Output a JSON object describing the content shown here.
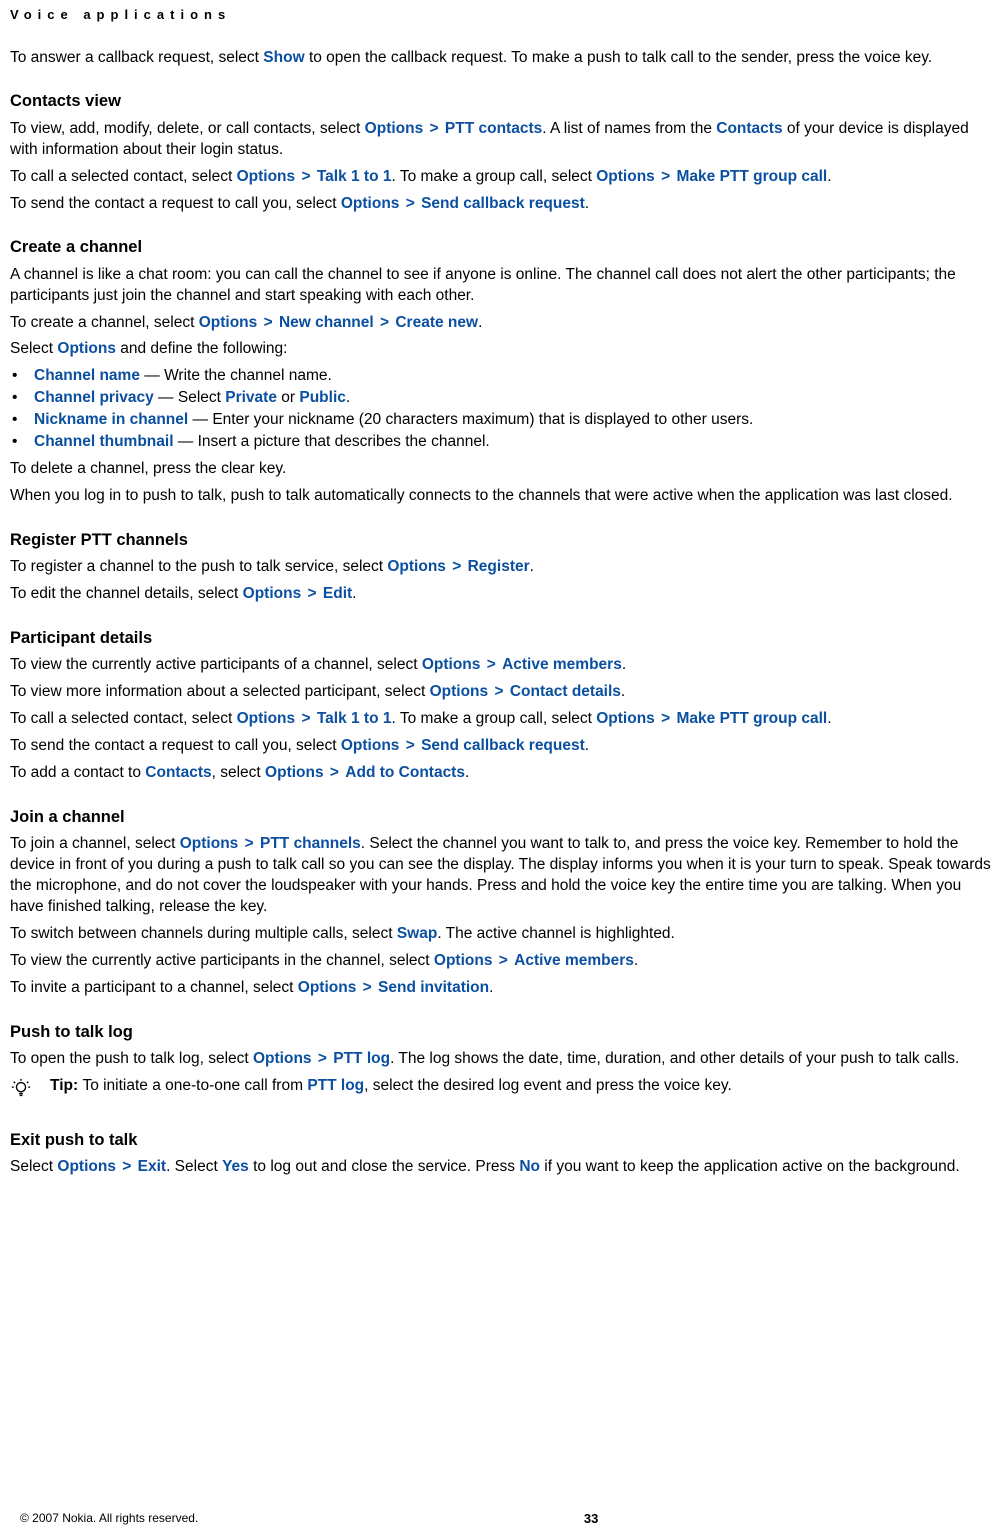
{
  "header": "Voice applications",
  "intro_p1_a": "To answer a callback request, select ",
  "intro_p1_show": "Show",
  "intro_p1_b": " to open the callback request. To make a push to talk call to the sender, press the voice key.",
  "contacts": {
    "h": "Contacts view",
    "p1a": "To view, add, modify, delete, or call contacts, select ",
    "opt": "Options",
    "ptt_contacts": "PTT contacts",
    "p1b": ". A list of names from the ",
    "contacts": "Contacts",
    "p1c": " of your device is displayed with information about their login status.",
    "p2a": "To call a selected contact, select ",
    "talk11": "Talk 1 to 1",
    "p2b": ". To make a group call, select ",
    "makeptt": "Make PTT group call",
    "p2c": ".",
    "p3a": "To send the contact a request to call you, select ",
    "sendcb": "Send callback request",
    "p3b": "."
  },
  "createch": {
    "h": "Create a channel",
    "p1": "A channel is like a chat room: you can call the channel to see if anyone is online. The channel call does not alert the other participants; the participants just join the channel and start speaking with each other.",
    "p2a": "To create a channel, select ",
    "opt": "Options",
    "newch": "New channel",
    "createnew": "Create new",
    "p2b": ".",
    "p3a": "Select ",
    "p3b": " and define the following:",
    "b1_l": "Channel name",
    "b1_r": "  — Write the channel name.",
    "b2_l": "Channel privacy",
    "b2_r_a": "  — Select ",
    "b2_private": "Private",
    "b2_or": " or ",
    "b2_public": "Public",
    "b2_dot": ".",
    "b3_l": "Nickname in channel",
    "b3_r": "  — Enter your nickname (20 characters maximum) that is displayed to other users.",
    "b4_l": "Channel thumbnail",
    "b4_r": "  — Insert a picture that describes the channel.",
    "p4": "To delete a channel, press the clear key.",
    "p5": "When you log in to push to talk, push to talk automatically connects to the channels that were active when the application was last closed."
  },
  "register": {
    "h": "Register PTT channels",
    "p1a": "To register a channel to the push to talk service, select ",
    "opt": "Options",
    "reg": "Register",
    "p1b": ".",
    "p2a": "To edit the channel details, select ",
    "edit": "Edit",
    "p2b": "."
  },
  "participant": {
    "h": "Participant details",
    "p1a": "To view the currently active participants of a channel, select ",
    "opt": "Options",
    "active": "Active members",
    "p1b": ".",
    "p2a": "To view more information about a selected participant, select ",
    "cdetails": "Contact details",
    "p2b": ".",
    "p3a": "To call a selected contact, select ",
    "talk11": "Talk 1 to 1",
    "p3b": ". To make a group call, select ",
    "makeptt": "Make PTT group call",
    "p3c": ".",
    "p4a": "To send the contact a request to call you, select ",
    "sendcb": "Send callback request",
    "p4b": ".",
    "p5a": "To add a contact to ",
    "contacts": "Contacts",
    "p5b": ", select ",
    "addto": "Add to Contacts",
    "p5c": "."
  },
  "join": {
    "h": "Join a channel",
    "p1a": "To join a channel, select ",
    "opt": "Options",
    "pttch": "PTT channels",
    "p1b": ". Select the channel you want to talk to, and press the voice key. Remember to hold the device in front of you during a push to talk call so you can see the display. The display informs you when it is your turn to speak. Speak towards the microphone, and do not cover the loudspeaker with your hands. Press and hold the voice key the entire time you are talking. When you have finished talking, release the key.",
    "p2a": "To switch between channels during multiple calls, select ",
    "swap": "Swap",
    "p2b": ". The active channel is highlighted.",
    "p3a": "To view the currently active participants in the channel, select ",
    "active": "Active members",
    "p3b": ".",
    "p4a": "To invite a participant to a channel, select ",
    "sendinv": "Send invitation",
    "p4b": "."
  },
  "pttlog": {
    "h": "Push to talk log",
    "p1a": "To open the push to talk log, select ",
    "opt": "Options",
    "pttlog": "PTT log",
    "p1b": ". The log shows the date, time, duration, and other details of your push to talk calls.",
    "tip_l": "Tip: ",
    "tip_a": "To initiate a one-to-one call from ",
    "tip_pttlog": "PTT log",
    "tip_b": ", select the desired log event and press the voice key."
  },
  "exit": {
    "h": "Exit push to talk",
    "p1a": "Select ",
    "opt": "Options",
    "exit": "Exit",
    "p1b": ". Select ",
    "yes": "Yes",
    "p1c": " to log out and close the service. Press ",
    "no": "No",
    "p1d": " if you want to keep the application active on the background."
  },
  "footer": {
    "copy": "© 2007 Nokia. All rights reserved.",
    "page": "33"
  }
}
